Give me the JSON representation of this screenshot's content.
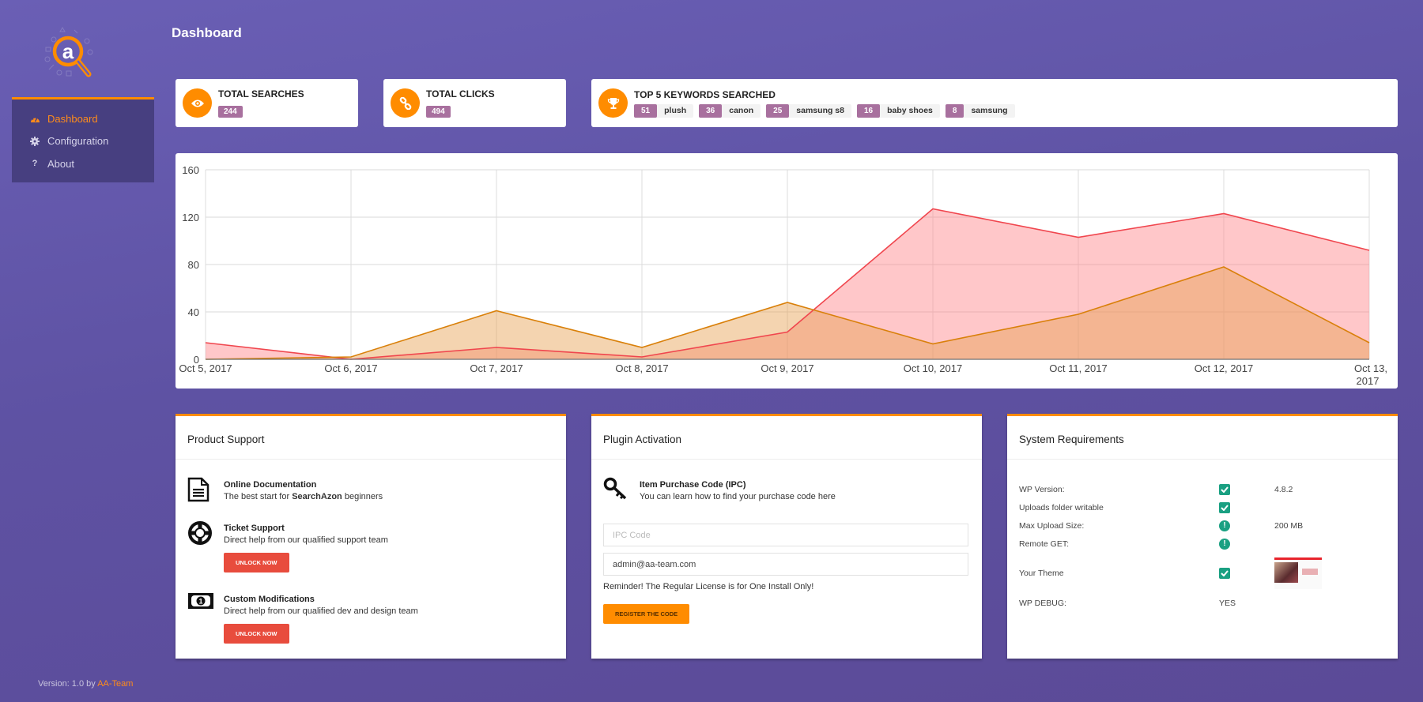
{
  "app": {
    "page_title": "Dashboard"
  },
  "sidebar": {
    "items": [
      {
        "label": "Dashboard",
        "icon": "dashboard-gauge-icon",
        "active": true
      },
      {
        "label": "Configuration",
        "icon": "gear-icon",
        "active": false
      },
      {
        "label": "About",
        "icon": "question-icon",
        "active": false
      }
    ],
    "version_prefix": "Version: 1.0 by ",
    "version_link": "AA-Team"
  },
  "stats": {
    "total_searches": {
      "title": "TOTAL SEARCHES",
      "value": "244",
      "icon": "eye-icon"
    },
    "total_clicks": {
      "title": "TOTAL CLICKS",
      "value": "494",
      "icon": "link-icon"
    },
    "top_keywords": {
      "title": "TOP 5 KEYWORDS SEARCHED",
      "icon": "trophy-icon",
      "items": [
        {
          "count": "51",
          "keyword": "plush"
        },
        {
          "count": "36",
          "keyword": "canon"
        },
        {
          "count": "25",
          "keyword": "samsung s8"
        },
        {
          "count": "16",
          "keyword": "baby shoes"
        },
        {
          "count": "8",
          "keyword": "samsung"
        }
      ]
    }
  },
  "colors": {
    "accent": "#ff8c00",
    "badge": "#a8709e",
    "red_series": "#f0464e",
    "orange_series": "#d9800a",
    "success": "#1aa082",
    "danger_button": "#e84c3d"
  },
  "chart_data": {
    "type": "area",
    "title": "",
    "xlabel": "",
    "ylabel": "",
    "ylim": [
      0,
      160
    ],
    "yticks": [
      0,
      40,
      80,
      120,
      160
    ],
    "grid": true,
    "legend": "none",
    "categories": [
      "Oct 5, 2017",
      "Oct 6, 2017",
      "Oct 7, 2017",
      "Oct 8, 2017",
      "Oct 9, 2017",
      "Oct 10, 2017",
      "Oct 11, 2017",
      "Oct 12, 2017",
      "Oct 13, 2017"
    ],
    "series": [
      {
        "name": "series-red",
        "color": "#f0464e",
        "fill": "rgba(255,130,135,0.45)",
        "values": [
          14,
          0,
          10,
          2,
          23,
          127,
          103,
          123,
          92
        ]
      },
      {
        "name": "series-orange",
        "color": "#d9800a",
        "fill": "rgba(230,160,80,0.45)",
        "values": [
          0,
          2,
          41,
          10,
          48,
          13,
          38,
          78,
          14
        ]
      }
    ]
  },
  "product_support": {
    "title": "Product Support",
    "items": [
      {
        "title": "Online Documentation",
        "desc_pre": "The best start for ",
        "desc_bold": "SearchAzon",
        "desc_post": " beginners",
        "icon": "document-icon"
      },
      {
        "title": "Ticket Support",
        "desc": "Direct help from our qualified support team",
        "button": "UNLOCK NOW",
        "icon": "lifebuoy-icon"
      },
      {
        "title": "Custom Modifications",
        "desc": "Direct help from our qualified dev and design team",
        "button": "UNLOCK NOW",
        "icon": "money-bill-icon"
      }
    ]
  },
  "plugin_activation": {
    "title": "Plugin Activation",
    "ipc_title": "Item Purchase Code (IPC)",
    "ipc_desc": "You can learn how to find your purchase code here",
    "ipc_placeholder": "IPC Code",
    "ipc_value": "",
    "email_value": "admin@aa-team.com",
    "reminder": "Reminder! The Regular License is for One Install Only!",
    "button": "REGISTER THE CODE"
  },
  "system_requirements": {
    "title": "System Requirements",
    "rows": [
      {
        "label": "WP Version:",
        "status": "check",
        "value": "4.8.2"
      },
      {
        "label": "Uploads folder writable",
        "status": "check",
        "value": ""
      },
      {
        "label": "Max Upload Size:",
        "status": "warning",
        "value": "200 MB"
      },
      {
        "label": "Remote GET:",
        "status": "warning",
        "value": ""
      },
      {
        "label": "Your Theme",
        "status": "check",
        "value": "theme-thumbnail"
      },
      {
        "label": "WP DEBUG:",
        "status": "YES",
        "value": ""
      }
    ]
  }
}
